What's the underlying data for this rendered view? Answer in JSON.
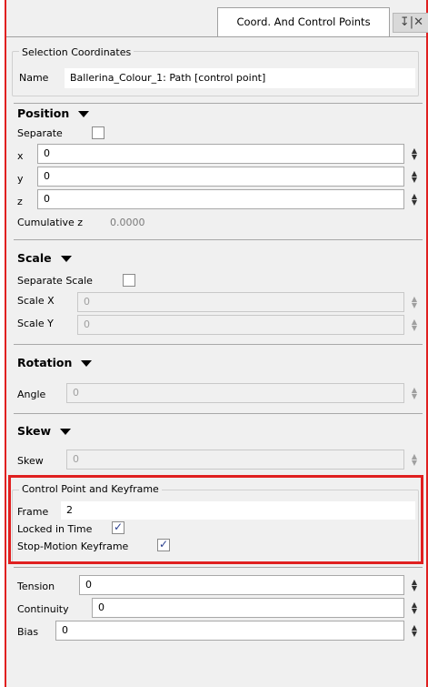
{
  "tab": {
    "title": "Coord. And Control Points",
    "icons": "↧|✕"
  },
  "selection": {
    "group_title": "Selection Coordinates",
    "name_label": "Name",
    "name_value": "Ballerina_Colour_1: Path [control point]"
  },
  "position": {
    "title": "Position",
    "separate_label": "Separate",
    "separate_checked": false,
    "x_label": "x",
    "x_value": "0",
    "y_label": "y",
    "y_value": "0",
    "z_label": "z",
    "z_value": "0",
    "cumz_label": "Cumulative z",
    "cumz_value": "0.0000"
  },
  "scale": {
    "title": "Scale",
    "separate_label": "Separate Scale",
    "separate_checked": false,
    "x_label": "Scale X",
    "x_value": "0",
    "y_label": "Scale Y",
    "y_value": "0"
  },
  "rotation": {
    "title": "Rotation",
    "angle_label": "Angle",
    "angle_value": "0"
  },
  "skew": {
    "title": "Skew",
    "skew_label": "Skew",
    "skew_value": "0"
  },
  "control_point": {
    "group_title": "Control Point and Keyframe",
    "frame_label": "Frame",
    "frame_value": "2",
    "locked_label": "Locked in Time",
    "locked_checked": true,
    "stop_label": "Stop-Motion Keyframe",
    "stop_checked": true
  },
  "curve": {
    "tension_label": "Tension",
    "tension_value": "0",
    "continuity_label": "Continuity",
    "continuity_value": "0",
    "bias_label": "Bias",
    "bias_value": "0"
  },
  "colors": {
    "highlight": "#e02020",
    "panel_bg": "#f0f0f0",
    "checkmark": "#2a3f8f"
  }
}
